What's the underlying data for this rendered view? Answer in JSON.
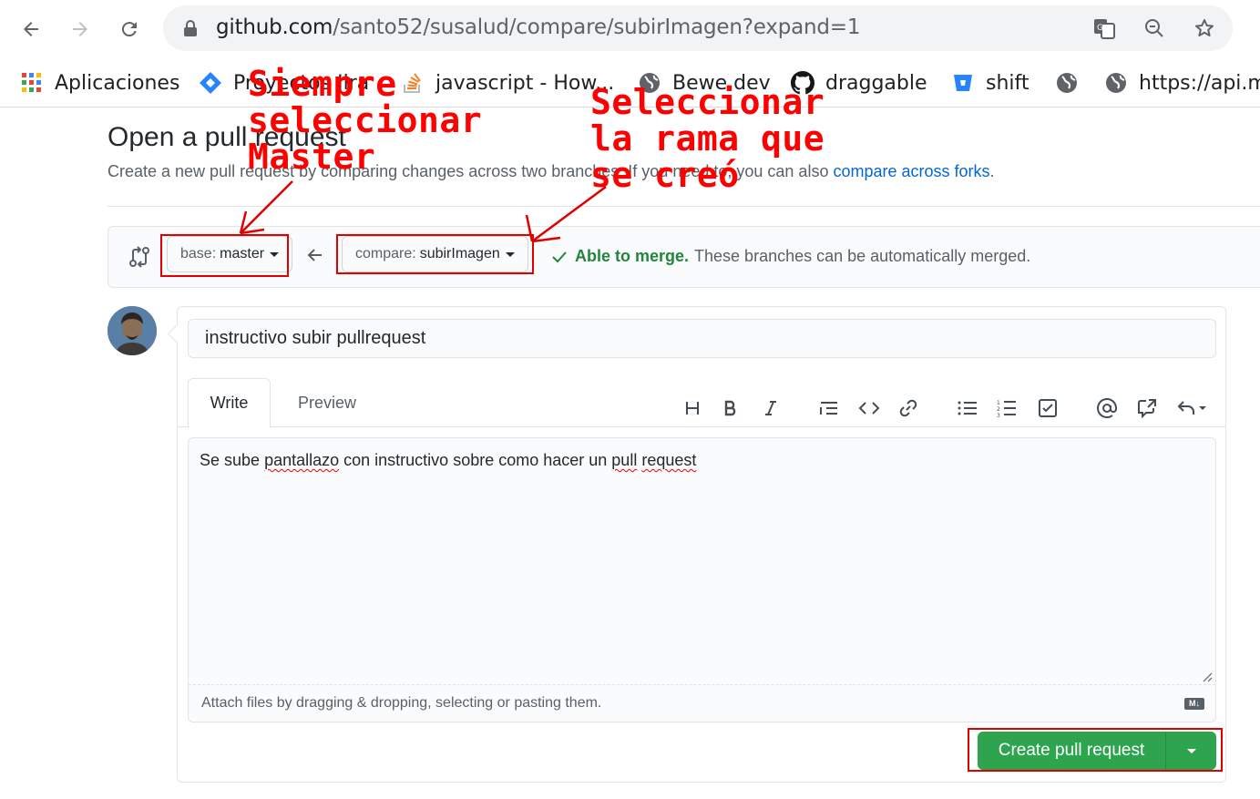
{
  "browser": {
    "url_host": "github.com",
    "url_path": "/santo52/susalud/compare/subirImagen?expand=1",
    "bookmarks": [
      {
        "label": "Aplicaciones",
        "icon": "apps-grid-icon"
      },
      {
        "label": "Proyectos Jira",
        "icon": "jira-icon"
      },
      {
        "label": "javascript - How...",
        "icon": "stackoverflow-icon"
      },
      {
        "label": "Bewe dev",
        "icon": "globe-icon"
      },
      {
        "label": "draggable",
        "icon": "github-icon"
      },
      {
        "label": "shift",
        "icon": "bitbucket-icon"
      },
      {
        "label": "",
        "icon": "globe-icon"
      },
      {
        "label": "https://api.m",
        "icon": "globe-icon"
      }
    ]
  },
  "page": {
    "title": "Open a pull request",
    "subhead_prefix": "Create a new pull request by comparing changes across two branches. If you need to, you can also ",
    "subhead_link": "compare across forks",
    "subhead_suffix": "."
  },
  "range": {
    "base_prefix": "base:",
    "base_branch": "master",
    "compare_prefix": "compare:",
    "compare_branch": "subirImagen",
    "merge_ok": "Able to merge.",
    "merge_text": "These branches can be automatically merged."
  },
  "form": {
    "title_value": "instructivo subir pullrequest",
    "tab_write": "Write",
    "tab_preview": "Preview",
    "body_part1": "Se sube ",
    "body_word1": "pantallazo",
    "body_part2": " con instructivo sobre como hacer un ",
    "body_word2": "pull",
    "body_part3": " ",
    "body_word3": "request",
    "attach_hint": "Attach files by dragging & dropping, selecting or pasting them.",
    "md_badge": "M↓",
    "submit_label": "Create pull request"
  },
  "annotations": {
    "left_note": "Siempre\nseleccionar\nMaster",
    "right_note": "Seleccionar\nla rama que\nse creó",
    "color": "#ff0000"
  },
  "colors": {
    "primary_green": "#2ea44f",
    "link_blue": "#0366d6",
    "merge_green": "#22863a"
  }
}
